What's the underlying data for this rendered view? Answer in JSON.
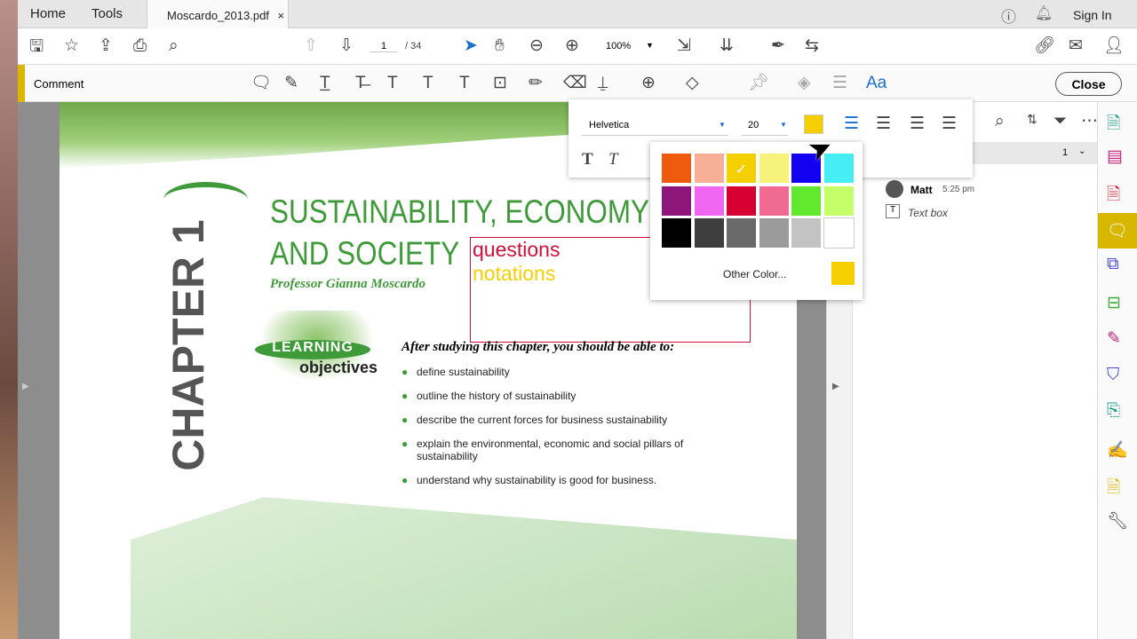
{
  "tabs": {
    "home": "Home",
    "tools": "Tools",
    "document": "Moscardo_2013.pdf",
    "close": "×"
  },
  "header": {
    "sign_in": "Sign In"
  },
  "toolbar": {
    "page_current": "1",
    "page_total": "/ 34",
    "zoom": "100%"
  },
  "comment_bar": {
    "label": "Comment",
    "close": "Close",
    "accent": "#d9b700"
  },
  "text_props": {
    "font": "Helvetica",
    "size": "20",
    "selected_color": "#f5cf00"
  },
  "color_picker": {
    "colors": [
      "#ef5b0c",
      "#f7b095",
      "#f5cf00",
      "#f6f27a",
      "#1300f0",
      "#45eef5",
      "#8e1579",
      "#ef66f1",
      "#d5002f",
      "#f06a92",
      "#62e82d",
      "#c4ff6a",
      "#000000",
      "#3e3e3e",
      "#6a6a6a",
      "#9b9b9b",
      "#c3c3c3",
      "#ffffff"
    ],
    "selected_index": 2,
    "other_label": "Other Color..."
  },
  "comments_panel": {
    "page": "1",
    "author": "Matt",
    "time": "5:25 pm",
    "type": "Text box"
  },
  "document": {
    "chapter": "CHAPTER 1",
    "title_line1": "SUSTAINABILITY, ECONOMY",
    "title_line2": "AND SOCIETY",
    "author": "Professor Gianna Moscardo",
    "textbox_line1": "questions",
    "textbox_line2": "notations",
    "logo_top": "LEARNING",
    "logo_bottom": "objectives",
    "intro": "After studying this chapter, you should be able to:",
    "objectives": [
      "define sustainability",
      "outline the history of sustainability",
      "describe the current forces for business sustainability",
      "explain the environmental, economic and social pillars of sustainability",
      "understand why sustainability is good for business."
    ]
  }
}
